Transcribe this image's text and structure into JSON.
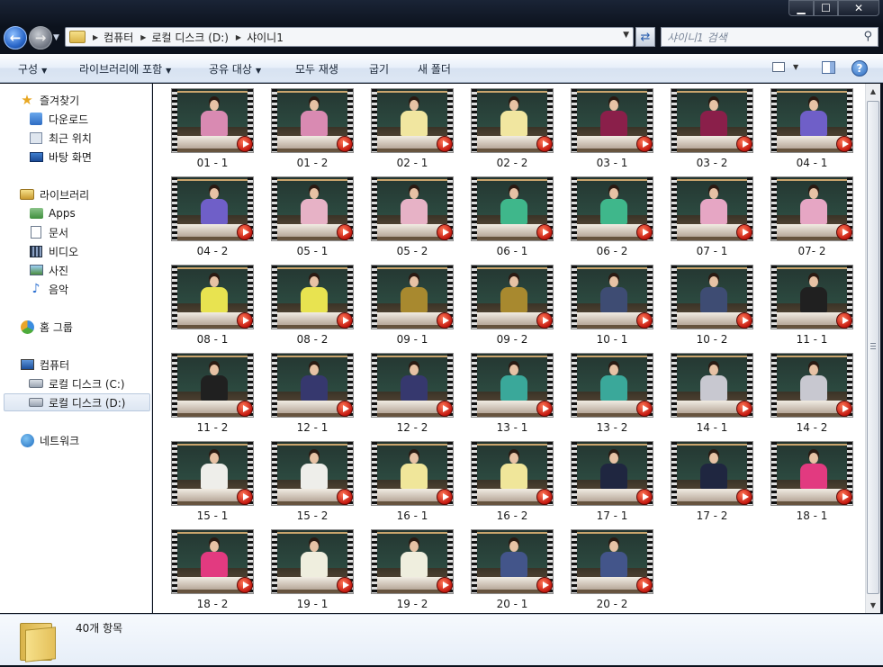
{
  "window": {
    "minimize_icon": "minimize-icon",
    "maximize_icon": "maximize-icon",
    "close_icon": "close-icon",
    "minimize_label": "▁",
    "maximize_label": "☐",
    "close_label": "✕"
  },
  "address": {
    "crumbs": [
      "컴퓨터",
      "로컬 디스크 (D:)",
      "샤이니1"
    ],
    "search_placeholder": "샤이니1 검색"
  },
  "toolbar": {
    "organize": "구성",
    "include_library": "라이브러리에 포함",
    "share_with": "공유 대상",
    "play_all": "모두 재생",
    "burn": "굽기",
    "new_folder": "새 폴더",
    "help_label": "?"
  },
  "nav": {
    "favorites": {
      "label": "즐겨찾기",
      "items": [
        "다운로드",
        "최근 위치",
        "바탕 화면"
      ]
    },
    "libraries": {
      "label": "라이브러리",
      "items": [
        "Apps",
        "문서",
        "비디오",
        "사진",
        "음악"
      ]
    },
    "homegroup": "홈 그룹",
    "computer": {
      "label": "컴퓨터",
      "items": [
        "로컬 디스크 (C:)",
        "로컬 디스크 (D:)"
      ],
      "selected": "로컬 디스크 (D:)"
    },
    "network": "네트워크"
  },
  "files": [
    {
      "name": "01 - 1",
      "top": "#d98ab2"
    },
    {
      "name": "01 - 2",
      "top": "#d98ab2"
    },
    {
      "name": "02 - 1",
      "top": "#f1e6a0"
    },
    {
      "name": "02 - 2",
      "top": "#f1e6a0"
    },
    {
      "name": "03 - 1",
      "top": "#8a1f4a"
    },
    {
      "name": "03 - 2",
      "top": "#8a1f4a"
    },
    {
      "name": "04 - 1",
      "top": "#6f5fc8"
    },
    {
      "name": "04 - 2",
      "top": "#6f5fc8"
    },
    {
      "name": "05 - 1",
      "top": "#e7b2c6"
    },
    {
      "name": "05 - 2",
      "top": "#e7b2c6"
    },
    {
      "name": "06 - 1",
      "top": "#3fb78b"
    },
    {
      "name": "06 - 2",
      "top": "#3fb78b"
    },
    {
      "name": "07 - 1",
      "top": "#e6a6c4"
    },
    {
      "name": "07- 2",
      "top": "#e6a6c4"
    },
    {
      "name": "08 - 1",
      "top": "#e8e350"
    },
    {
      "name": "08 - 2",
      "top": "#e8e350"
    },
    {
      "name": "09 - 1",
      "top": "#a8892f"
    },
    {
      "name": "09 - 2",
      "top": "#a8892f"
    },
    {
      "name": "10 - 1",
      "top": "#3e4c73"
    },
    {
      "name": "10 - 2",
      "top": "#3e4c73"
    },
    {
      "name": "11 - 1",
      "top": "#202020"
    },
    {
      "name": "11 - 2",
      "top": "#202020"
    },
    {
      "name": "12 - 1",
      "top": "#36386e"
    },
    {
      "name": "12 - 2",
      "top": "#36386e"
    },
    {
      "name": "13 - 1",
      "top": "#3aa89a"
    },
    {
      "name": "13 - 2",
      "top": "#3aa89a"
    },
    {
      "name": "14 - 1",
      "top": "#c8c8d0"
    },
    {
      "name": "14 - 2",
      "top": "#c8c8d0"
    },
    {
      "name": "15 - 1",
      "top": "#eeeeea"
    },
    {
      "name": "15 - 2",
      "top": "#eeeeea"
    },
    {
      "name": "16 - 1",
      "top": "#f0e69a"
    },
    {
      "name": "16 - 2",
      "top": "#f0e69a"
    },
    {
      "name": "17 - 1",
      "top": "#1f2640"
    },
    {
      "name": "17 - 2",
      "top": "#1f2640"
    },
    {
      "name": "18 - 1",
      "top": "#e23a80"
    },
    {
      "name": "18 - 2",
      "top": "#e23a80"
    },
    {
      "name": "19 - 1",
      "top": "#efeede"
    },
    {
      "name": "19 - 2",
      "top": "#efeede"
    },
    {
      "name": "20 - 1",
      "top": "#43558a"
    },
    {
      "name": "20 - 2",
      "top": "#43558a"
    }
  ],
  "details": {
    "count": "40개 항목"
  },
  "colors": {
    "accent": "#2a67c9",
    "play_badge": "#c3170e",
    "board": "#2c4a40"
  }
}
